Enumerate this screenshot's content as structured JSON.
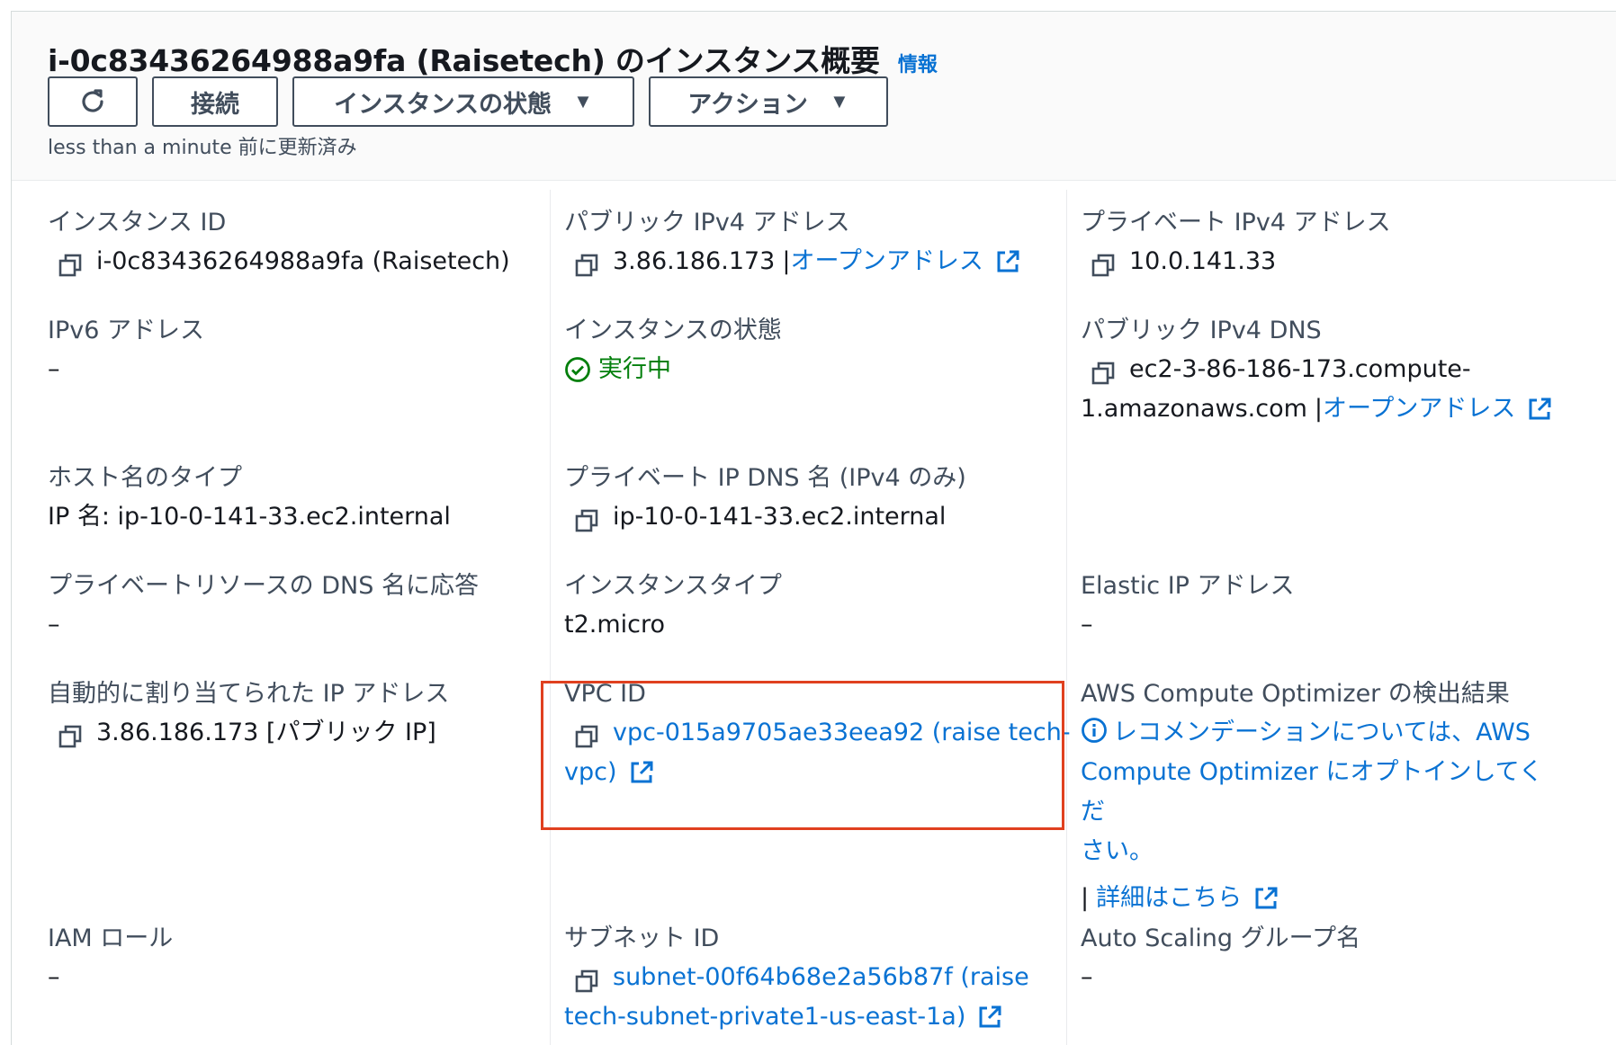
{
  "header": {
    "title": "i-0c83436264988a9fa (Raisetech) のインスタンス概要",
    "info_link": "情報",
    "buttons": {
      "connect": "接続",
      "instance_state": "インスタンスの状態",
      "actions": "アクション"
    },
    "updated": "less than a minute 前に更新済み"
  },
  "columns": {
    "left": {
      "instance_id": {
        "label": "インスタンス ID",
        "value": "i-0c83436264988a9fa (Raisetech)"
      },
      "ipv6": {
        "label": "IPv6 アドレス",
        "value": "–"
      },
      "hostname_type": {
        "label": "ホスト名のタイプ",
        "value": "IP 名: ip-10-0-141-33.ec2.internal"
      },
      "private_dns_answer": {
        "label": "プライベートリソースの DNS 名に応答",
        "value": "–"
      },
      "auto_ip": {
        "label": "自動的に割り当てられた IP アドレス",
        "value": "3.86.186.173 [パブリック IP]"
      },
      "iam_role": {
        "label": "IAM ロール",
        "value": "–"
      }
    },
    "middle": {
      "public_ipv4": {
        "label": "パブリック IPv4 アドレス",
        "value": "3.86.186.173",
        "sep": "|",
        "link": "オープンアドレス"
      },
      "instance_state": {
        "label": "インスタンスの状態",
        "value": "実行中"
      },
      "private_ip_dns": {
        "label": "プライベート IP DNS 名 (IPv4 のみ)",
        "value": "ip-10-0-141-33.ec2.internal"
      },
      "instance_type": {
        "label": "インスタンスタイプ",
        "value": "t2.micro"
      },
      "vpc_id": {
        "label": "VPC ID",
        "link_line1": "vpc-015a9705ae33eea92 (raise tech-",
        "link_line2": "vpc)"
      },
      "subnet_id": {
        "label": "サブネット ID",
        "link_line1": "subnet-00f64b68e2a56b87f (raise",
        "link_line2": "tech-subnet-private1-us-east-1a)"
      }
    },
    "right": {
      "private_ipv4": {
        "label": "プライベート IPv4 アドレス",
        "value": "10.0.141.33"
      },
      "public_dns": {
        "label": "パブリック IPv4 DNS",
        "value_line1": "ec2-3-86-186-173.compute-",
        "value_line2": "1.amazonaws.com",
        "sep": "|",
        "link": "オープンアドレス"
      },
      "elastic_ip": {
        "label": "Elastic IP アドレス",
        "value": "–"
      },
      "optimizer": {
        "label": "AWS Compute Optimizer の検出結果",
        "line1": "レコメンデーションについては、AWS",
        "line2": "Compute Optimizer にオプトインしてくだ",
        "line3": "さい。",
        "sep": "|",
        "details_link": "詳細はこちら"
      },
      "autoscaling": {
        "label": "Auto Scaling グループ名",
        "value": "–"
      }
    }
  },
  "colors": {
    "link": "#0972d3",
    "running": "#037f0c",
    "highlight": "#e0401f"
  }
}
